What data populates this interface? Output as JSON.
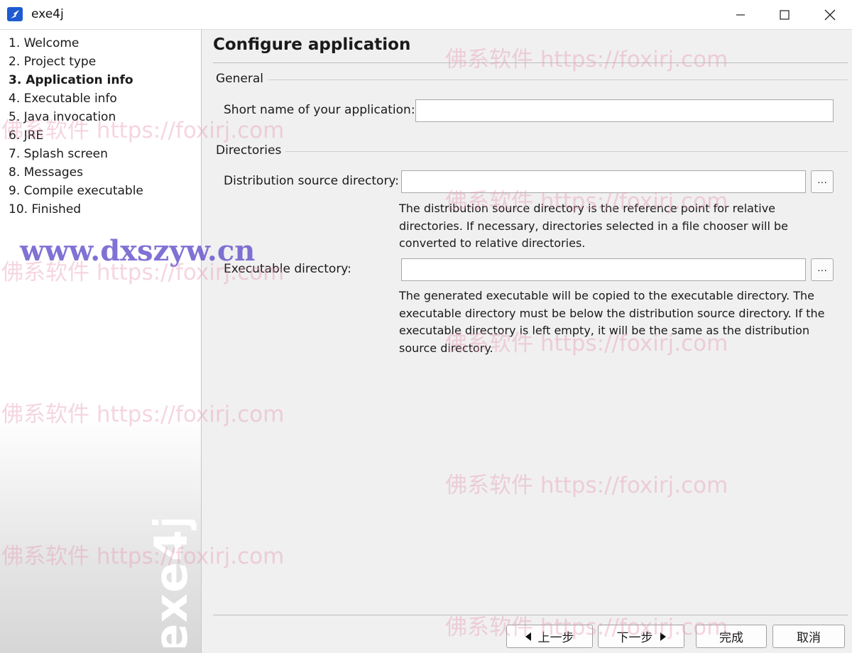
{
  "window": {
    "title": "exe4j"
  },
  "steps": [
    {
      "label": "1. Welcome",
      "active": false
    },
    {
      "label": "2. Project type",
      "active": false
    },
    {
      "label": "3. Application info",
      "active": true
    },
    {
      "label": "4. Executable info",
      "active": false
    },
    {
      "label": "5. Java invocation",
      "active": false
    },
    {
      "label": "6. JRE",
      "active": false
    },
    {
      "label": "7. Splash screen",
      "active": false
    },
    {
      "label": "8. Messages",
      "active": false
    },
    {
      "label": "9. Compile executable",
      "active": false
    },
    {
      "label": "10. Finished",
      "active": false
    }
  ],
  "brand": "exe4j",
  "site_mark": "www.dxszyw.cn",
  "page": {
    "title": "Configure application",
    "general": {
      "title": "General",
      "short_name_label": "Short name of your application:",
      "short_name_value": ""
    },
    "directories": {
      "title": "Directories",
      "dist_label": "Distribution source directory:",
      "dist_value": "",
      "dist_help": "The distribution source directory is the reference point for relative directories. If necessary, directories selected in a file chooser will be converted to relative directories.",
      "exe_label": "Executable directory:",
      "exe_value": "",
      "exe_help": "The generated executable will be copied to the executable directory. The executable directory must be below the distribution source directory. If the executable directory is left empty, it will be the same as the distribution source directory.",
      "browse_label": "···"
    }
  },
  "footer": {
    "back_label": "上一步",
    "next_label": "下一步",
    "finish_label": "完成",
    "cancel_label": "取消"
  },
  "watermark": "佛系软件 https://foxirj.com",
  "colors": {
    "accent": "#1e5bd1",
    "watermark": "#e696b4"
  }
}
